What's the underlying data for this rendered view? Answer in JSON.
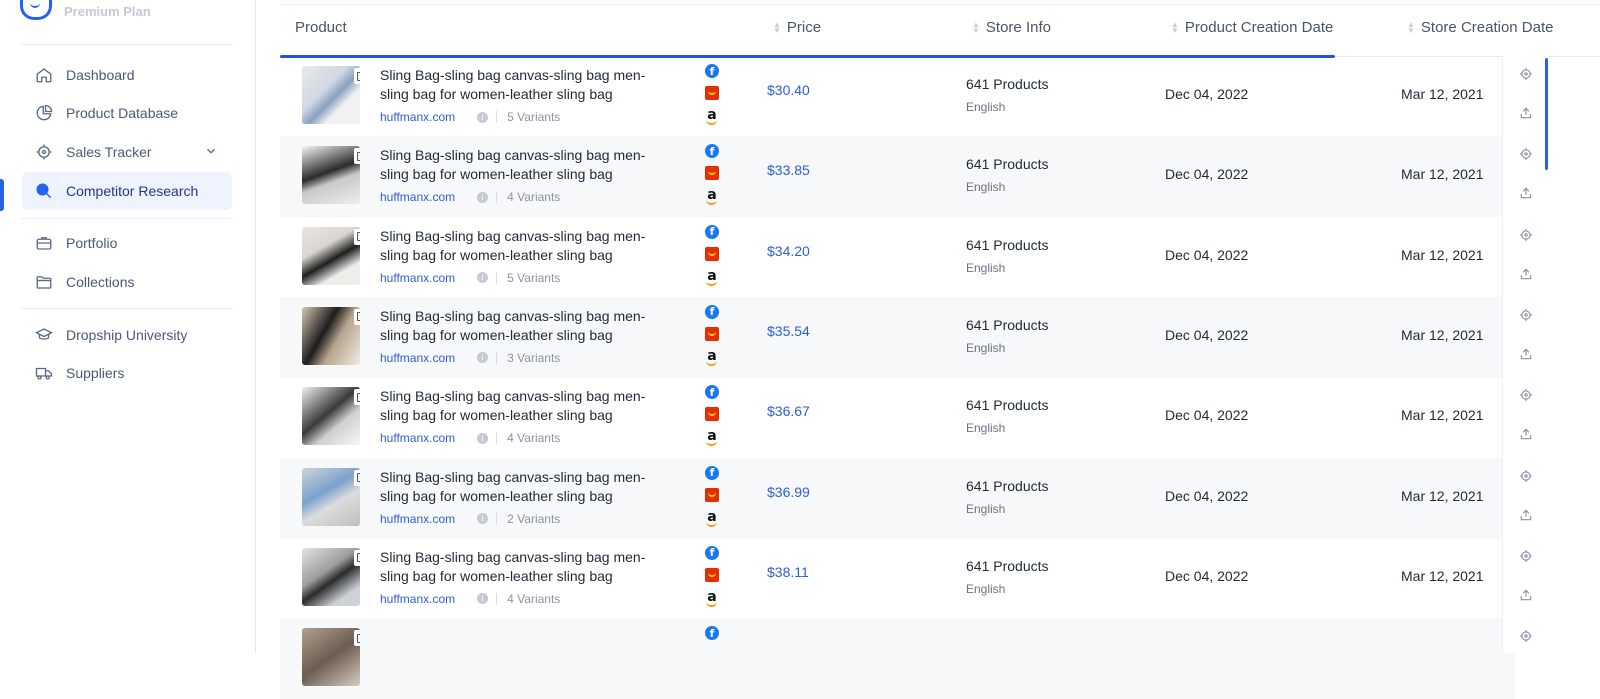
{
  "sidebar": {
    "plan": "Premium Plan",
    "items": [
      {
        "label": "Dashboard",
        "icon": "home-icon"
      },
      {
        "label": "Product Database",
        "icon": "pie-chart-icon"
      },
      {
        "label": "Sales Tracker",
        "icon": "crosshair-icon"
      },
      {
        "label": "Competitor Research",
        "icon": "search-icon",
        "active": true
      },
      {
        "label": "Portfolio",
        "icon": "briefcase-icon"
      },
      {
        "label": "Collections",
        "icon": "folder-icon"
      },
      {
        "label": "Dropship University",
        "icon": "graduation-cap-icon"
      },
      {
        "label": "Suppliers",
        "icon": "truck-icon"
      }
    ]
  },
  "table": {
    "headers": {
      "product": "Product",
      "price": "Price",
      "store_info": "Store Info",
      "product_creation_date": "Product Creation Date",
      "store_creation_date": "Store Creation Date"
    },
    "rows": [
      {
        "images": "5",
        "title": "Sling Bag-sling bag canvas-sling bag men-sling bag for women-leather sling bag",
        "store": "huffmanx.com",
        "variants": "5 Variants",
        "price": "$30.40",
        "products": "641 Products",
        "language": "English",
        "product_date": "Dec 04, 2022",
        "store_date": "Mar 12, 2021"
      },
      {
        "images": "5",
        "title": "Sling Bag-sling bag canvas-sling bag men-sling bag for women-leather sling bag",
        "store": "huffmanx.com",
        "variants": "4 Variants",
        "price": "$33.85",
        "products": "641 Products",
        "language": "English",
        "product_date": "Dec 04, 2022",
        "store_date": "Mar 12, 2021"
      },
      {
        "images": "5",
        "title": "Sling Bag-sling bag canvas-sling bag men-sling bag for women-leather sling bag",
        "store": "huffmanx.com",
        "variants": "5 Variants",
        "price": "$34.20",
        "products": "641 Products",
        "language": "English",
        "product_date": "Dec 04, 2022",
        "store_date": "Mar 12, 2021"
      },
      {
        "images": "5",
        "title": "Sling Bag-sling bag canvas-sling bag men-sling bag for women-leather sling bag",
        "store": "huffmanx.com",
        "variants": "3 Variants",
        "price": "$35.54",
        "products": "641 Products",
        "language": "English",
        "product_date": "Dec 04, 2022",
        "store_date": "Mar 12, 2021"
      },
      {
        "images": "5",
        "title": "Sling Bag-sling bag canvas-sling bag men-sling bag for women-leather sling bag",
        "store": "huffmanx.com",
        "variants": "4 Variants",
        "price": "$36.67",
        "products": "641 Products",
        "language": "English",
        "product_date": "Dec 04, 2022",
        "store_date": "Mar 12, 2021"
      },
      {
        "images": "5",
        "title": "Sling Bag-sling bag canvas-sling bag men-sling bag for women-leather sling bag",
        "store": "huffmanx.com",
        "variants": "2 Variants",
        "price": "$36.99",
        "products": "641 Products",
        "language": "English",
        "product_date": "Dec 04, 2022",
        "store_date": "Mar 12, 2021"
      },
      {
        "images": "5",
        "title": "Sling Bag-sling bag canvas-sling bag men-sling bag for women-leather sling bag",
        "store": "huffmanx.com",
        "variants": "4 Variants",
        "price": "$38.11",
        "products": "641 Products",
        "language": "English",
        "product_date": "Dec 04, 2022",
        "store_date": "Mar 12, 2021"
      },
      {
        "images": "1",
        "title": "",
        "store": "",
        "variants": "",
        "price": "",
        "products": "",
        "language": "",
        "product_date": "",
        "store_date": ""
      }
    ]
  },
  "colors": {
    "accent": "#2563eb",
    "price": "#2c5fd6",
    "row_alt": "#f7f8fa"
  }
}
